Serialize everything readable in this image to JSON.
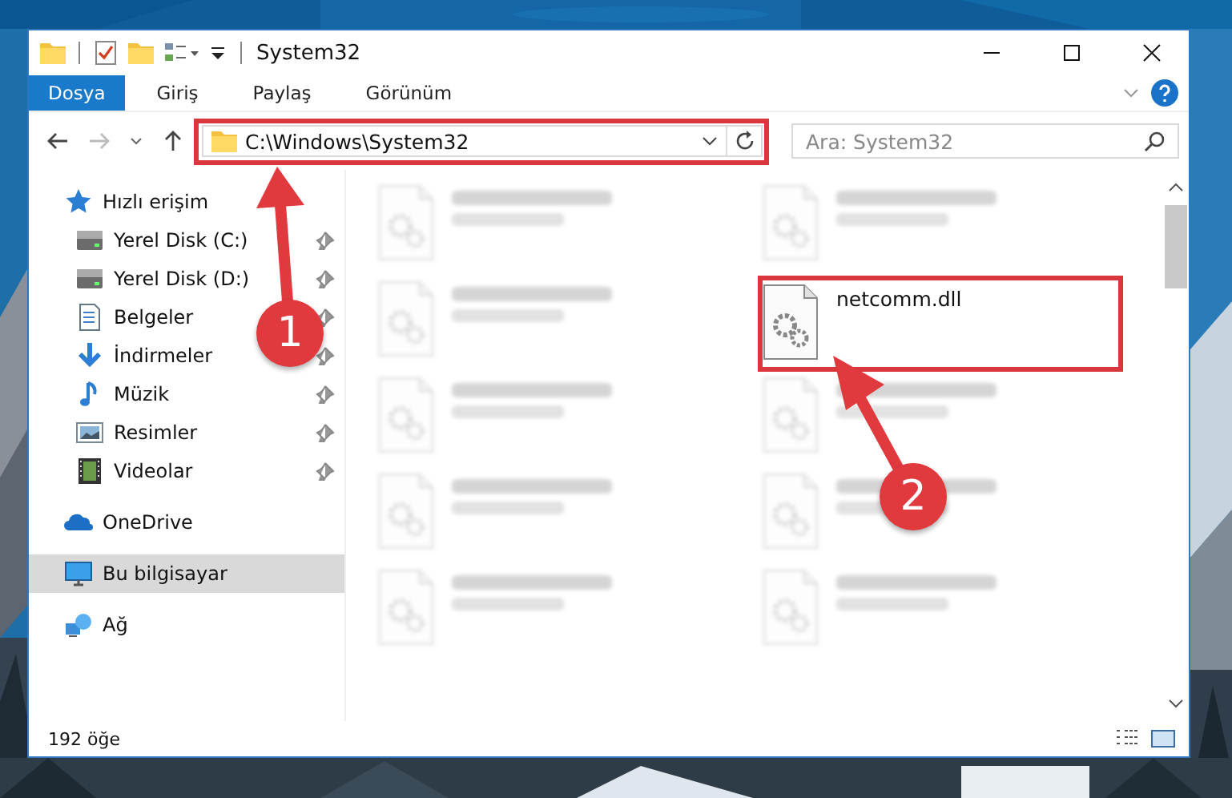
{
  "window": {
    "title": "System32"
  },
  "ribbon_tabs": [
    {
      "label": "Dosya",
      "selected": true
    },
    {
      "label": "Giriş",
      "selected": false
    },
    {
      "label": "Paylaş",
      "selected": false
    },
    {
      "label": "Görünüm",
      "selected": false
    }
  ],
  "address": {
    "path": "C:\\Windows\\System32"
  },
  "search": {
    "placeholder": "Ara: System32"
  },
  "sidebar": {
    "items": [
      {
        "label": "Hızlı erişim",
        "kind": "star",
        "selected": false,
        "children": [
          {
            "label": "Yerel Disk (C:)",
            "kind": "drive",
            "pinned": true,
            "selected": false
          },
          {
            "label": "Yerel Disk (D:)",
            "kind": "drive",
            "pinned": true,
            "selected": false
          },
          {
            "label": "Belgeler",
            "kind": "documents",
            "pinned": true,
            "selected": false
          },
          {
            "label": "İndirmeler",
            "kind": "downloads",
            "pinned": true,
            "selected": false
          },
          {
            "label": "Müzik",
            "kind": "music",
            "pinned": true,
            "selected": false
          },
          {
            "label": "Resimler",
            "kind": "pictures",
            "pinned": true,
            "selected": false
          },
          {
            "label": "Videolar",
            "kind": "videos",
            "pinned": true,
            "selected": false
          }
        ]
      },
      {
        "label": "OneDrive",
        "kind": "cloud",
        "selected": false
      },
      {
        "label": "Bu bilgisayar",
        "kind": "computer",
        "selected": true
      },
      {
        "label": "Ağ",
        "kind": "network",
        "selected": false
      }
    ]
  },
  "files": [
    {
      "kind": "blurred"
    },
    {
      "kind": "blurred"
    },
    {
      "kind": "blurred"
    },
    {
      "kind": "file",
      "name": "netcomm.dll"
    },
    {
      "kind": "blurred"
    },
    {
      "kind": "blurred"
    },
    {
      "kind": "blurred"
    },
    {
      "kind": "blurred"
    },
    {
      "kind": "blurred"
    },
    {
      "kind": "blurred"
    }
  ],
  "status_bar": {
    "count": "192 öğe"
  },
  "annotations": [
    {
      "kind": "step",
      "number": "1"
    },
    {
      "kind": "step",
      "number": "2"
    }
  ]
}
